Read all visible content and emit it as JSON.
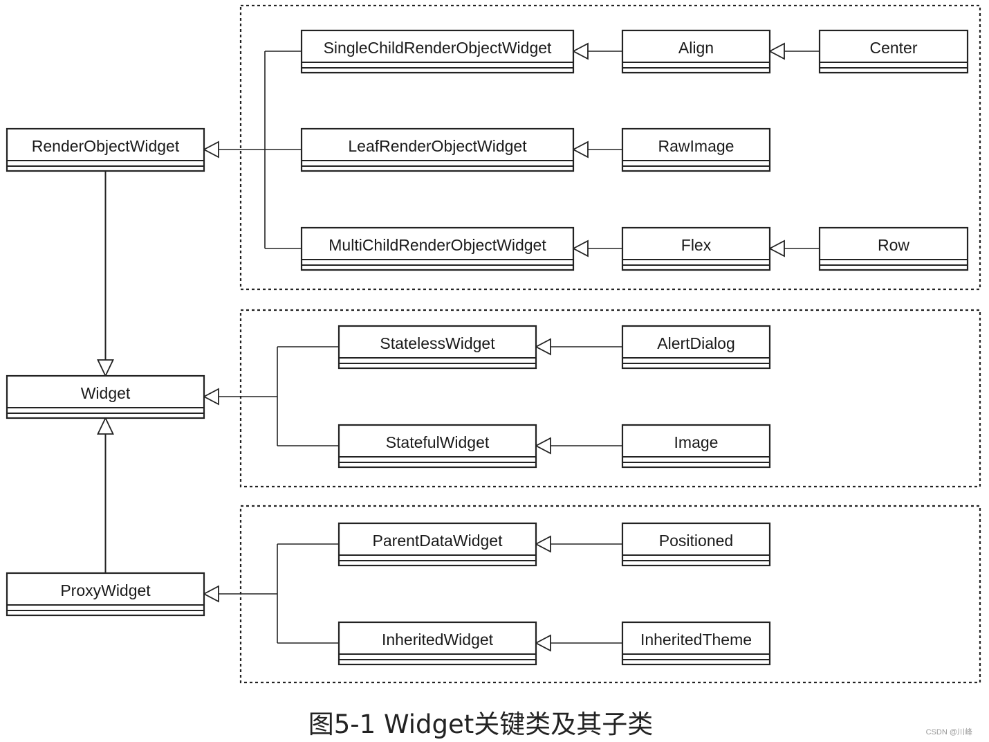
{
  "boxes": [
    {
      "id": "render-object-widget",
      "label": "RenderObjectWidget"
    },
    {
      "id": "widget",
      "label": "Widget"
    },
    {
      "id": "proxy-widget",
      "label": "ProxyWidget"
    },
    {
      "id": "single-child-render-object-widget",
      "label": "SingleChildRenderObjectWidget"
    },
    {
      "id": "leaf-render-object-widget",
      "label": "LeafRenderObjectWidget"
    },
    {
      "id": "multi-child-render-object-widget",
      "label": "MultiChildRenderObjectWidget"
    },
    {
      "id": "align",
      "label": "Align"
    },
    {
      "id": "raw-image",
      "label": "RawImage"
    },
    {
      "id": "flex",
      "label": "Flex"
    },
    {
      "id": "center",
      "label": "Center"
    },
    {
      "id": "row",
      "label": "Row"
    },
    {
      "id": "stateless-widget",
      "label": "StatelessWidget"
    },
    {
      "id": "stateful-widget",
      "label": "StatefulWidget"
    },
    {
      "id": "alert-dialog",
      "label": "AlertDialog"
    },
    {
      "id": "image",
      "label": "Image"
    },
    {
      "id": "parent-data-widget",
      "label": "ParentDataWidget"
    },
    {
      "id": "inherited-widget",
      "label": "InheritedWidget"
    },
    {
      "id": "positioned",
      "label": "Positioned"
    },
    {
      "id": "inherited-theme",
      "label": "InheritedTheme"
    }
  ],
  "inheritance": [
    {
      "child": "render-object-widget",
      "parent": "widget"
    },
    {
      "child": "proxy-widget",
      "parent": "widget"
    },
    {
      "child": "single-child-render-object-widget",
      "parent": "render-object-widget"
    },
    {
      "child": "leaf-render-object-widget",
      "parent": "render-object-widget"
    },
    {
      "child": "multi-child-render-object-widget",
      "parent": "render-object-widget"
    },
    {
      "child": "align",
      "parent": "single-child-render-object-widget"
    },
    {
      "child": "center",
      "parent": "align"
    },
    {
      "child": "raw-image",
      "parent": "leaf-render-object-widget"
    },
    {
      "child": "flex",
      "parent": "multi-child-render-object-widget"
    },
    {
      "child": "row",
      "parent": "flex"
    },
    {
      "child": "stateless-widget",
      "parent": "widget"
    },
    {
      "child": "stateful-widget",
      "parent": "widget"
    },
    {
      "child": "alert-dialog",
      "parent": "stateless-widget"
    },
    {
      "child": "image",
      "parent": "stateful-widget"
    },
    {
      "child": "parent-data-widget",
      "parent": "proxy-widget"
    },
    {
      "child": "inherited-widget",
      "parent": "proxy-widget"
    },
    {
      "child": "positioned",
      "parent": "parent-data-widget"
    },
    {
      "child": "inherited-theme",
      "parent": "inherited-widget"
    }
  ],
  "caption": "图5-1 Widget关键类及其子类",
  "watermark": "CSDN @川峰",
  "colors": {
    "stroke": "#222222",
    "background": "#ffffff"
  }
}
